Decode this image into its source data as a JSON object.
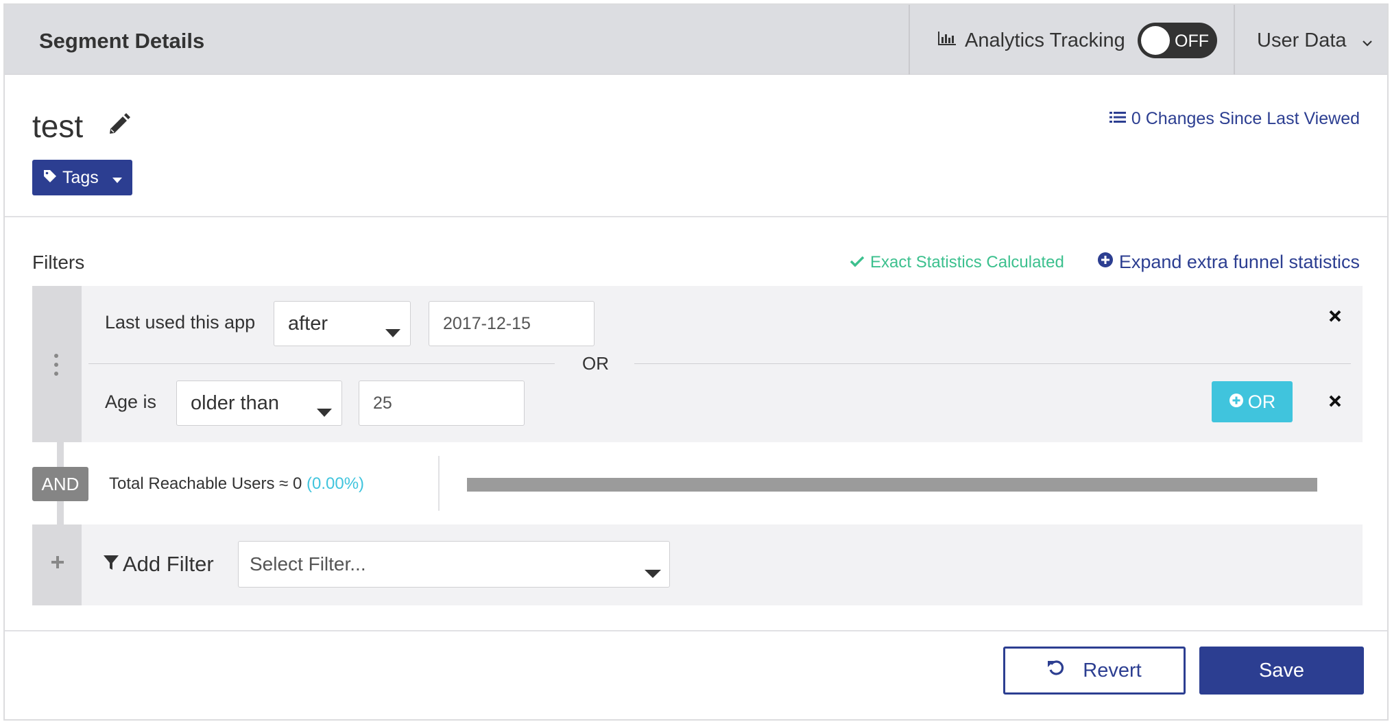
{
  "header": {
    "title": "Segment Details",
    "analytics_label": "Analytics Tracking",
    "analytics_icon": "bar-chart-icon",
    "toggle_state": "OFF",
    "user_data_label": "User Data"
  },
  "segment": {
    "name": "test",
    "tags_label": "Tags",
    "changes_label": "0 Changes Since Last Viewed"
  },
  "filters": {
    "label": "Filters",
    "exact_stats": "Exact Statistics Calculated",
    "expand_stats": "Expand extra funnel statistics",
    "rows": [
      {
        "label": "Last used this app",
        "operator": "after",
        "value": "2017-12-15"
      },
      {
        "label": "Age is",
        "operator": "older than",
        "value": "25"
      }
    ],
    "or_separator": "OR",
    "or_button": "OR",
    "and_badge": "AND",
    "reachable_prefix": "Total Reachable Users ≈ 0",
    "reachable_pct": "(0.00%)",
    "reachable_fraction": 0,
    "add_filter_label": "Add Filter",
    "select_placeholder": "Select Filter..."
  },
  "footer": {
    "revert_label": "Revert",
    "save_label": "Save"
  },
  "colors": {
    "primary": "#2c3e91",
    "accent": "#40c4dd",
    "success": "#3cc08e",
    "header_bg": "#dcdde1"
  }
}
